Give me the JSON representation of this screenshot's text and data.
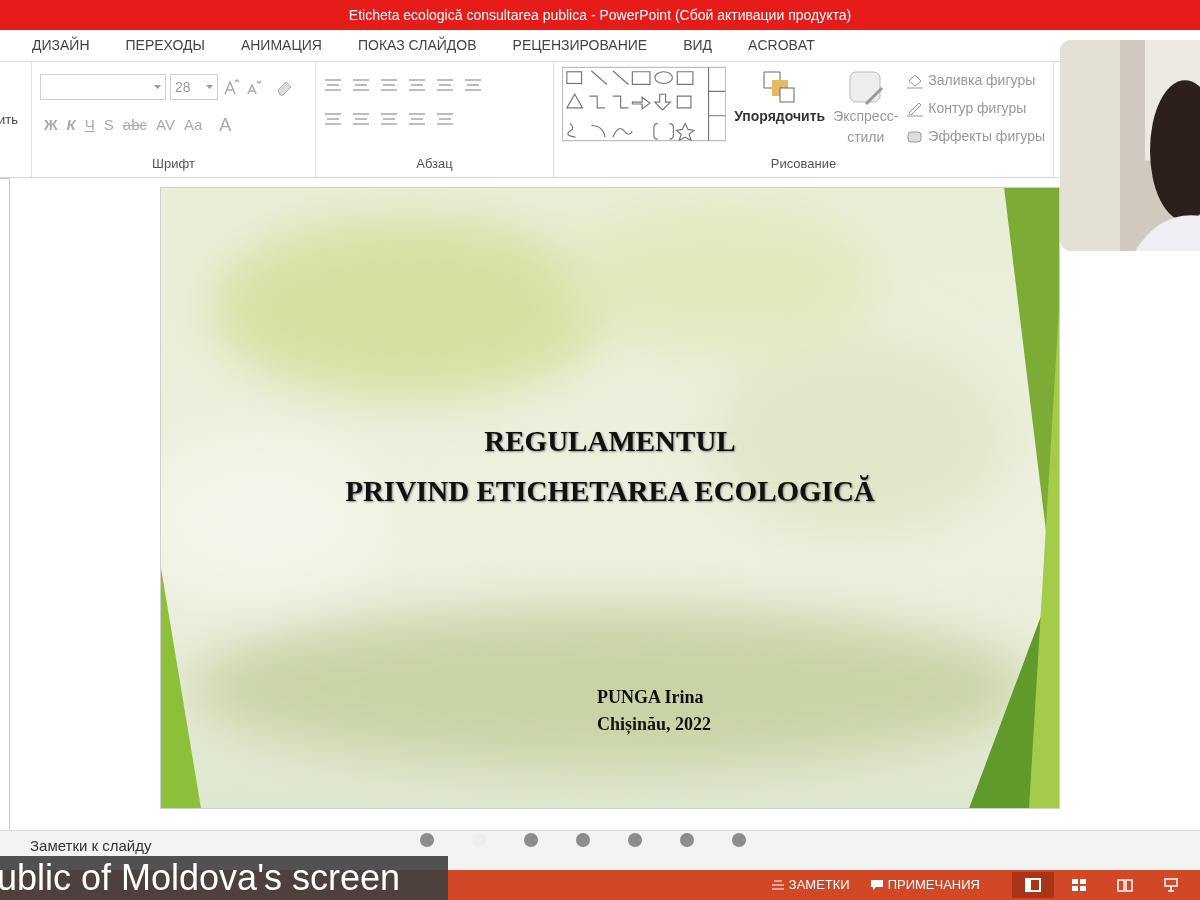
{
  "window": {
    "title": "Eticheta ecologică consultarea publica -  PowerPoint (Сбой активации продукта)"
  },
  "tabs": [
    {
      "label": "ДИЗАЙН",
      "selected": false
    },
    {
      "label": "ПЕРЕХОДЫ",
      "selected": false
    },
    {
      "label": "АНИМАЦИЯ",
      "selected": false
    },
    {
      "label": "ПОКАЗ СЛАЙДОВ",
      "selected": false
    },
    {
      "label": "РЕЦЕНЗИРОВАНИЕ",
      "selected": false
    },
    {
      "label": "ВИД",
      "selected": false
    },
    {
      "label": "ACROBAT",
      "selected": false
    }
  ],
  "ribbon": {
    "clipboard": {
      "label": "ить"
    },
    "font": {
      "label": "Шрифт",
      "size": "28",
      "buttons": [
        "Ж",
        "К",
        "Ч",
        "S",
        "abc",
        "AV",
        "Aa",
        "A"
      ]
    },
    "paragraph": {
      "label": "Абзац"
    },
    "drawing": {
      "label": "Рисование",
      "arrange": "Упорядочить",
      "styles": [
        "Экспресс-",
        "стили"
      ],
      "commands": [
        {
          "kind": "fill",
          "label": "Заливка фигуры"
        },
        {
          "kind": "outline",
          "label": "Контур фигуры"
        },
        {
          "kind": "effects",
          "label": "Эффекты фигуры"
        }
      ]
    }
  },
  "slide": {
    "title_lines": [
      "REGULAMENTUL",
      "PRIVIND ETICHETAREA ECOLOGICĂ"
    ],
    "author": "PUNGA Irina",
    "place": "Chișinău, 2022"
  },
  "pager": [
    {
      "selected": false
    },
    {
      "selected": true
    },
    {
      "selected": false
    },
    {
      "selected": false
    },
    {
      "selected": false
    },
    {
      "selected": false
    },
    {
      "selected": false
    }
  ],
  "notes": {
    "placeholder": "Заметки к слайду"
  },
  "share_label": "ublic of Moldova's screen",
  "status_bar": {
    "notes": "ЗАМЕТКИ",
    "comments": "ПРИМЕЧАНИЯ",
    "views": [
      {
        "kind": "normal",
        "selected": true
      },
      {
        "kind": "sorter",
        "selected": false
      },
      {
        "kind": "reading",
        "selected": false
      },
      {
        "kind": "show",
        "selected": false
      }
    ]
  }
}
